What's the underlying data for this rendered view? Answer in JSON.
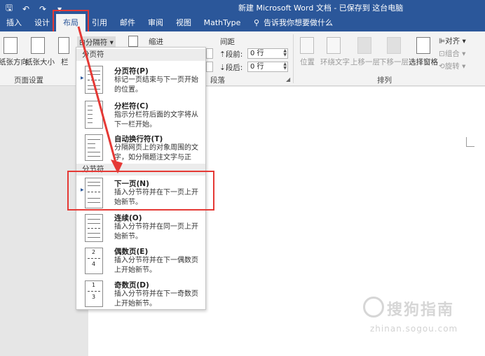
{
  "titlebar": {
    "qat_icons": [
      "save-icon",
      "undo-icon",
      "redo-icon",
      "customize-icon"
    ],
    "qat_glyphs": [
      "🖫",
      "↶",
      "↷",
      "▾"
    ],
    "document_title": "新建 Microsoft Word 文档 - 已保存到 这台电脑"
  },
  "tabs": {
    "insert": "插入",
    "design": "设计",
    "layout": "布局",
    "references": "引用",
    "mailings": "邮件",
    "review": "审阅",
    "view": "视图",
    "mathtype": "MathType",
    "tell_me": "告诉我你想要做什么"
  },
  "ribbon": {
    "page_setup": {
      "orientation": "纸张方向",
      "size": "纸张大小",
      "columns": "栏",
      "breaks": "分隔符",
      "label": "页面设置"
    },
    "indent_label": "缩进",
    "spacing_label": "间距",
    "spacing_before_label": "段前:",
    "spacing_before_value": "0 行",
    "spacing_after_label": "段后:",
    "spacing_after_value": "0 行",
    "paragraph_label": "段落",
    "arrange": {
      "position": "位置",
      "wrap_text": "环绕文字",
      "bring_forward": "上移一层",
      "send_backward": "下移一层",
      "selection_pane": "选择窗格",
      "align": "对齐",
      "group": "组合",
      "rotate": "旋转",
      "label": "排列"
    }
  },
  "breaks_menu": {
    "page_breaks_header": "分页符",
    "section_breaks_header": "分节符",
    "items": [
      {
        "title": "分页符(P)",
        "desc": "标记一页结束与下一页开始的位置。"
      },
      {
        "title": "分栏符(C)",
        "desc": "指示分栏符后面的文字将从下一栏开始。"
      },
      {
        "title": "自动换行符(T)",
        "desc": "分隔网页上的对象周围的文字，如分隔题注文字与正文。"
      },
      {
        "title": "下一页(N)",
        "desc": "插入分节符并在下一页上开始新节。"
      },
      {
        "title": "连续(O)",
        "desc": "插入分节符并在同一页上开始新节。"
      },
      {
        "title": "偶数页(E)",
        "desc": "插入分节符并在下一偶数页上开始新节。"
      },
      {
        "title": "奇数页(D)",
        "desc": "插入分节符并在下一奇数页上开始新节。"
      }
    ],
    "even_icon_number": "2",
    "even_icon_number2": "4",
    "odd_icon_number": "1",
    "odd_icon_number2": "3"
  },
  "watermark": {
    "text": "搜狗指南",
    "sub": "zhinan.sogou.com"
  },
  "colors": {
    "accent": "#2b579a",
    "annotation": "#e53935"
  }
}
